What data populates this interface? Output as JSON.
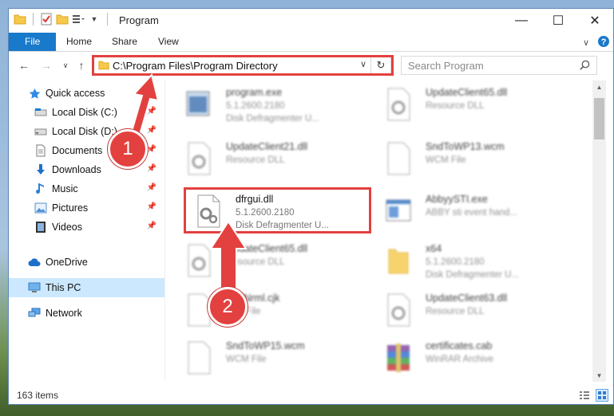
{
  "window": {
    "title": "Program"
  },
  "ribbon": {
    "tabs": [
      "File",
      "Home",
      "Share",
      "View"
    ]
  },
  "address": {
    "path": "C:\\Program Files\\Program Directory"
  },
  "search": {
    "placeholder": "Search Program"
  },
  "sidebar": {
    "items": [
      {
        "label": "Quick access",
        "icon": "star-icon"
      },
      {
        "label": "Local Disk (C:)",
        "icon": "drive-icon"
      },
      {
        "label": "Local Disk (D:)",
        "icon": "drive-icon"
      },
      {
        "label": "Documents",
        "icon": "documents-icon"
      },
      {
        "label": "Downloads",
        "icon": "download-icon"
      },
      {
        "label": "Music",
        "icon": "music-icon"
      },
      {
        "label": "Pictures",
        "icon": "pictures-icon"
      },
      {
        "label": "Videos",
        "icon": "videos-icon"
      },
      {
        "label": "OneDrive",
        "icon": "cloud-icon"
      },
      {
        "label": "This PC",
        "icon": "computer-icon"
      },
      {
        "label": "Network",
        "icon": "network-icon"
      }
    ]
  },
  "files": [
    {
      "name": "program.exe",
      "line1": "5.1.2600.2180",
      "line2": "Disk Defragmenter U..."
    },
    {
      "name": "UpdateClient65.dll",
      "line1": "Resource DLL",
      "line2": ""
    },
    {
      "name": "UpdateClient21.dll",
      "line1": "Resource DLL",
      "line2": ""
    },
    {
      "name": "SndToWP13.wcm",
      "line1": "WCM File",
      "line2": ""
    },
    {
      "name": "dfrgui.dll",
      "line1": "5.1.2600.2180",
      "line2": "Disk Defragmenter U..."
    },
    {
      "name": "AbbyySTI.exe",
      "line1": "ABBY sti event hand...",
      "line2": ""
    },
    {
      "name": "UpdateClient65.dll",
      "line1": "Resource DLL",
      "line2": ""
    },
    {
      "name": "x64",
      "line1": "5.1.2600.2180",
      "line2": "Disk Defragmenter U..."
    },
    {
      "name": "SndNrml.cjk",
      "line1": "CJK File",
      "line2": ""
    },
    {
      "name": "UpdateClient63.dll",
      "line1": "Resource DLL",
      "line2": ""
    },
    {
      "name": "SndToWP15.wcm",
      "line1": "WCM File",
      "line2": ""
    },
    {
      "name": "certificates.cab",
      "line1": "WinRAR Archive",
      "line2": ""
    }
  ],
  "status": {
    "items": "163 items"
  },
  "annotations": {
    "badge1": "1",
    "badge2": "2"
  },
  "colors": {
    "accent": "#1979ca",
    "highlight": "#e2413f",
    "selected": "#cce8ff"
  }
}
